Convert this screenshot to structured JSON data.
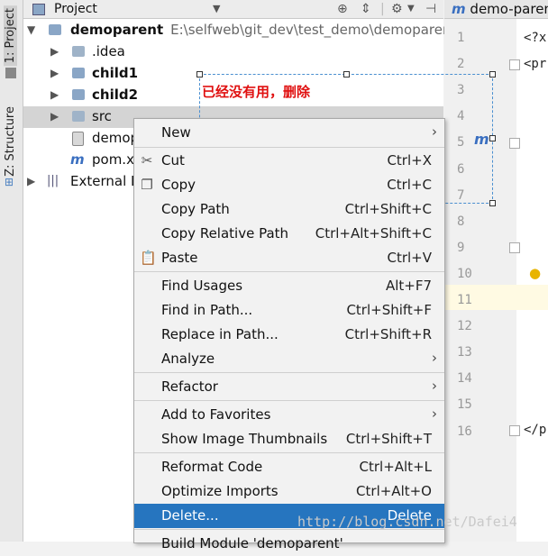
{
  "sidebar": {
    "project_tab": "1: Project",
    "structure_tab": "Z: Structure"
  },
  "toolbar": {
    "title": "Project",
    "dropdown": "▼",
    "icons": [
      "target-icon",
      "collapse-icon",
      "gear-icon",
      "hide-icon"
    ]
  },
  "tree": {
    "root_name": "demoparent",
    "root_path": "E:\\selfweb\\git_dev\\test_demo\\demoparent",
    "items": [
      {
        "label": ".idea"
      },
      {
        "label": "child1"
      },
      {
        "label": "child2"
      },
      {
        "label": "src"
      },
      {
        "label": "demop"
      },
      {
        "label": "pom.x"
      },
      {
        "label": "External L"
      }
    ]
  },
  "editor": {
    "tab_title": "demo-parent",
    "line_numbers": [
      "1",
      "2",
      "3",
      "4",
      "5",
      "6",
      "7",
      "8",
      "9",
      "10",
      "11",
      "12",
      "13",
      "14",
      "15",
      "16"
    ],
    "code_lines": {
      "l1": "<?x",
      "l2": "<pr",
      "l16": "</p"
    }
  },
  "annotation": {
    "text": "已经没有用，删除"
  },
  "context_menu": {
    "new": {
      "label": "New"
    },
    "cut": {
      "label": "Cut",
      "shortcut": "Ctrl+X"
    },
    "copy": {
      "label": "Copy",
      "shortcut": "Ctrl+C"
    },
    "copy_path": {
      "label": "Copy Path",
      "shortcut": "Ctrl+Shift+C"
    },
    "copy_relative_path": {
      "label": "Copy Relative Path",
      "shortcut": "Ctrl+Alt+Shift+C"
    },
    "paste": {
      "label": "Paste",
      "shortcut": "Ctrl+V"
    },
    "find_usages": {
      "label": "Find Usages",
      "shortcut": "Alt+F7"
    },
    "find_in_path": {
      "label": "Find in Path...",
      "shortcut": "Ctrl+Shift+F"
    },
    "replace_in_path": {
      "label": "Replace in Path...",
      "shortcut": "Ctrl+Shift+R"
    },
    "analyze": {
      "label": "Analyze"
    },
    "refactor": {
      "label": "Refactor"
    },
    "add_to_favorites": {
      "label": "Add to Favorites"
    },
    "show_image_thumbnails": {
      "label": "Show Image Thumbnails",
      "shortcut": "Ctrl+Shift+T"
    },
    "reformat_code": {
      "label": "Reformat Code",
      "shortcut": "Ctrl+Alt+L"
    },
    "optimize_imports": {
      "label": "Optimize Imports",
      "shortcut": "Ctrl+Alt+O"
    },
    "delete": {
      "label": "Delete...",
      "shortcut": "Delete"
    },
    "build_module": {
      "label": "Build Module 'demoparent'"
    }
  },
  "watermark": "http://blog.csdn.net/Dafei4",
  "colors": {
    "selection": "#2675bf",
    "annotation_text": "#e01010",
    "annotation_border": "#4a8fd0"
  }
}
